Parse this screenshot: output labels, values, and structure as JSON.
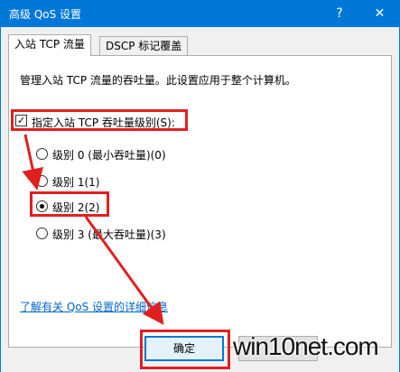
{
  "window": {
    "title": "高级 QoS 设置",
    "help": "?",
    "close": "✕"
  },
  "tabs": [
    {
      "label": "入站 TCP 流量"
    },
    {
      "label": "DSCP 标记覆盖"
    }
  ],
  "panel": {
    "description": "管理入站 TCP 流量的吞吐量。此设置应用于整个计算机。",
    "checkbox": {
      "label": "指定入站 TCP 吞吐量级别(S):",
      "checked": true
    },
    "radios": [
      {
        "label": "级别 0 (最小吞吐量)(0)",
        "selected": false
      },
      {
        "label": "级别 1(1)",
        "selected": false
      },
      {
        "label": "级别 2(2)",
        "selected": true
      },
      {
        "label": "级别 3 (最大吞吐量)(3)",
        "selected": false
      }
    ],
    "link": "了解有关 QoS 设置的详细信息"
  },
  "buttons": {
    "ok": "确定",
    "cancel": ""
  },
  "watermark": "win10net.com",
  "colors": {
    "titlebar": "#0078d7",
    "highlight": "#e02020",
    "link": "#0066cc"
  },
  "icons": [
    "help-icon",
    "close-icon",
    "check-icon"
  ]
}
